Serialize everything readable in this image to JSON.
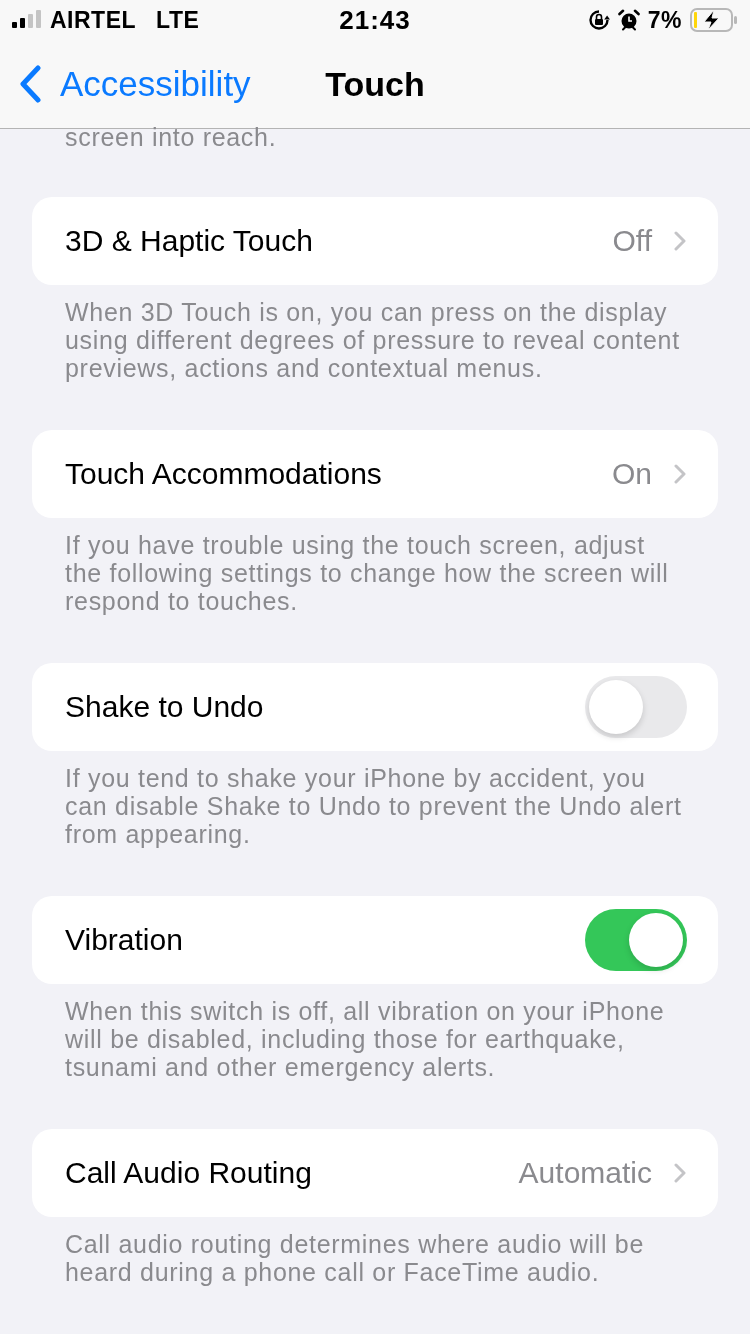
{
  "status_bar": {
    "carrier": "AIRTEL",
    "network": "LTE",
    "time": "21:43",
    "battery_percent": "7%"
  },
  "nav": {
    "back": "Accessibility",
    "title": "Touch"
  },
  "clipped_footer": "screen into reach.",
  "groups": [
    {
      "kind": "link",
      "label": "3D & Haptic Touch",
      "value": "Off",
      "footer": "When 3D Touch is on, you can press on the display using different degrees of pressure to reveal content previews, actions and contextual menus."
    },
    {
      "kind": "link",
      "label": "Touch Accommodations",
      "value": "On",
      "footer": "If you have trouble using the touch screen, adjust the following settings to change how the screen will respond to touches."
    },
    {
      "kind": "toggle",
      "label": "Shake to Undo",
      "on": false,
      "footer": "If you tend to shake your iPhone by accident, you can disable Shake to Undo to prevent the Undo alert from appearing."
    },
    {
      "kind": "toggle",
      "label": "Vibration",
      "on": true,
      "footer": "When this switch is off, all vibration on your iPhone will be disabled, including those for earthquake, tsunami and other emergency alerts."
    },
    {
      "kind": "link",
      "label": "Call Audio Routing",
      "value": "Automatic",
      "footer": "Call audio routing determines where audio will be heard during a phone call or FaceTime audio."
    }
  ]
}
